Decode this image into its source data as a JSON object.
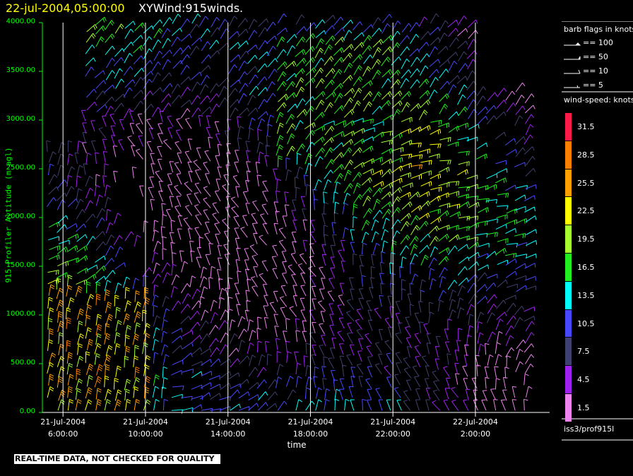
{
  "title": {
    "date": "22-jul-2004,05:00:00",
    "description": "XYWind:915winds."
  },
  "chart_data": {
    "type": "wind-barb-profile",
    "xlabel": "time",
    "ylabel": "915 Profiler Altitude (m agl)",
    "ylim": [
      0,
      4000
    ],
    "y_ticks": [
      "0.00",
      "500.00",
      "1000.00",
      "1500.00",
      "2000.00",
      "2500.00",
      "3000.00",
      "3500.00",
      "4000.00"
    ],
    "x_ticks": [
      {
        "date": "21-Jul-2004",
        "time": "6:00:00"
      },
      {
        "date": "21-Jul-2004",
        "time": "10:00:00"
      },
      {
        "date": "21-Jul-2004",
        "time": "14:00:00"
      },
      {
        "date": "21-Jul-2004",
        "time": "18:00:00"
      },
      {
        "date": "21-Jul-2004",
        "time": "22:00:00"
      },
      {
        "date": "22-Jul-2004",
        "time": "2:00:00"
      }
    ],
    "x_hours": [
      6,
      10,
      14,
      18,
      22,
      26
    ],
    "x_range_hours": [
      5.0,
      29.6
    ],
    "grid_vertical": true,
    "legend_placement": "right"
  },
  "legend": {
    "flags_title": "barb flags in knots",
    "flags": [
      "== 100",
      "== 50",
      "== 10",
      "== 5"
    ],
    "speed_title": "wind-speed: knots",
    "speed_bins": [
      {
        "label": "31.5",
        "color": "#ff1a4a"
      },
      {
        "label": "28.5",
        "color": "#ff8000"
      },
      {
        "label": "25.5",
        "color": "#ffa000"
      },
      {
        "label": "22.5",
        "color": "#ffff00"
      },
      {
        "label": "19.5",
        "color": "#a8ff30"
      },
      {
        "label": "16.5",
        "color": "#20f020"
      },
      {
        "label": "13.5",
        "color": "#00ffff"
      },
      {
        "label": "10.5",
        "color": "#4848ff"
      },
      {
        "label": "7.5",
        "color": "#404070"
      },
      {
        "label": "4.5",
        "color": "#a020f0"
      },
      {
        "label": "1.5",
        "color": "#ee82ee"
      }
    ],
    "station": "iss3/prof915l"
  },
  "footer": "REAL-TIME DATA, NOT CHECKED FOR QUALITY",
  "colors": {
    "date": "#ffff00",
    "axis": "#00ff00",
    "grid": "#ffffff",
    "background": "#000000"
  }
}
